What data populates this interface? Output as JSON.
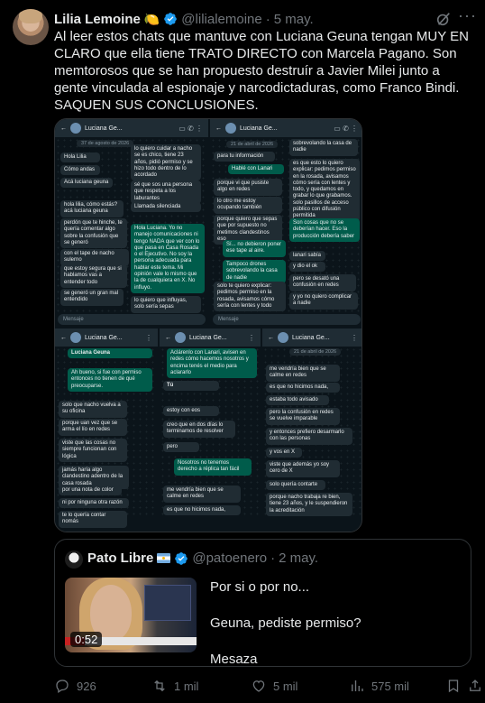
{
  "author": {
    "name": "Lilia Lemoine",
    "emoji": "🍋",
    "handle": "@lilialemoine",
    "separator": "·",
    "date": "5 may."
  },
  "tweet_text": "Al leer estos chats que mantuve con Luciana Geuna tengan MUY EN CLARO que ella tiene TRATO DIRECTO con Marcela Pagano. Son memtorosos que se han propuesto destruír a Javier Milei junto a gente vinculada al espionaje y narcodictaduras, como Franco Bindi. SAQUEN SUS CONCLUSIONES.",
  "screenshots": {
    "contact_a": "Luciana Ge...",
    "contact_b": "Luciana Ge...",
    "contact_c": "Luciana Ge...",
    "contact_d": "Luciana Ge...",
    "contact_e": "Luciana Ge...",
    "input_placeholder": "Mensaje",
    "s1": {
      "date": "37 de agosto de 2026",
      "msgs": [
        "Hola Lilia",
        "Cómo andas",
        "Acá luciana geuna",
        "hola lilia, cómo estás? acá luciana geuna",
        "perdón que te hinche, te quería comentar algo sobre la confusión que se generó",
        "con el tape de nacho sulerno",
        "que estoy segura que si hablamos vas a entender todo",
        "se generó un gran mal entendido",
        "lo quiero cuidar a nacho se es chico, tiene 23 años, pidió permiso y se hizo todo dentro de lo acordado",
        "sé que sos una persona que respeta a los laburantes",
        "Llamada silenciada",
        "Hola Luciana. Yo no manejo comunicaciones ni tengo NADA que ver con lo que pasa en Casa Rosada o el Ejecutivo. No soy la persona adecuada para hablar este tema. Mi opinión vale lo mismo que la de cualquiera en X. No influyo.",
        "lo quiero que influyas, solo sería sepas"
      ]
    },
    "s2": {
      "date": "21 de abril de 2026",
      "msgs": [
        "para tu información",
        "Hablé con Lanari",
        "porque vi que pusiste algo en redes",
        "lo otro me estoy ocupando también",
        "porque quiero que sepas que por supuesto no metimos clandestinos eso",
        "Sí... no debieron poner ese tape al aire.",
        "Tampoco drones sobrevolando la casa de nadie",
        "solo te quiero explicar: pedimos permiso en la rosada, avisamos cómo sería con lentes y todo",
        "sobrevolando la casa de nadie",
        "es que esto lo quiero explicar: pedimos permiso en la rosada, avisamos cómo sería con lentes y todo, y quedamos en grabar lo que grabamos. solo pasillos de acceso público con difusión permitida",
        "Son cosas que no se deberían hacer. Eso la producción debería saber",
        "lanari sabía",
        "y dio el ok",
        "pero se desató una confusión en redes",
        "y yo no quiero complicar a nadie"
      ]
    },
    "s3": {
      "msgs": [
        "Luciana Geuna",
        "Ah bueno, si fue con permiso entonces no tienen de qué preocuparse.",
        "solo que nacho vuelva a su oficina",
        "porque uan vez que se arma el lío en redes",
        "viste que las cosas no siempre funcionan con lógica",
        "jamás haría algo clandestino adentro de la casa rosada",
        "por una nota de color",
        "ni por ninguna otra razón",
        "te lo quería contar nomás"
      ]
    },
    "s4": {
      "msgs": [
        "Aclárenlo con Lanari, avisen en redes cómo hacemos nosotros y encima tenés el medio para aclararlo",
        "Tú",
        "estoy con eos",
        "creo que en dos días lo terminamos de resolver",
        "pero",
        "Nosotros no tenemos derecho a réplica tan fácil",
        "me vendría bien que se calme en redes",
        "es que no hicimos nada,"
      ]
    },
    "s5": {
      "date": "21 de abril de 2026",
      "msgs": [
        "me vendría bien que se calme en redes",
        "es que no hicimos nada,",
        "estaba todo avisado",
        "pero la confusión en redes se vuelve imparable",
        "y entonces prefiero desarmarlo con las personas",
        "y vos en X",
        "viste que además yo soy cero de X",
        "solo quería contarte",
        "porque nacho trabaja re bien, tiene 23 años, y le suspendieron la acreditación"
      ]
    }
  },
  "quote": {
    "name": "Pato Libre",
    "flag": "argentina-flag-icon",
    "handle": "@patoenero",
    "separator": "·",
    "date": "2 may.",
    "video_duration": "0:52",
    "lines": [
      "Por si o por no...",
      "Geuna, pediste permiso?",
      "Mesaza"
    ]
  },
  "actions": {
    "replies": "926",
    "reposts": "1 mil",
    "likes": "5 mil",
    "views": "575 mil"
  },
  "colors": {
    "verified": "#1d9bf0",
    "muted": "#71767b",
    "wa_incoming": "#202c33",
    "wa_outgoing": "#005c4b"
  }
}
